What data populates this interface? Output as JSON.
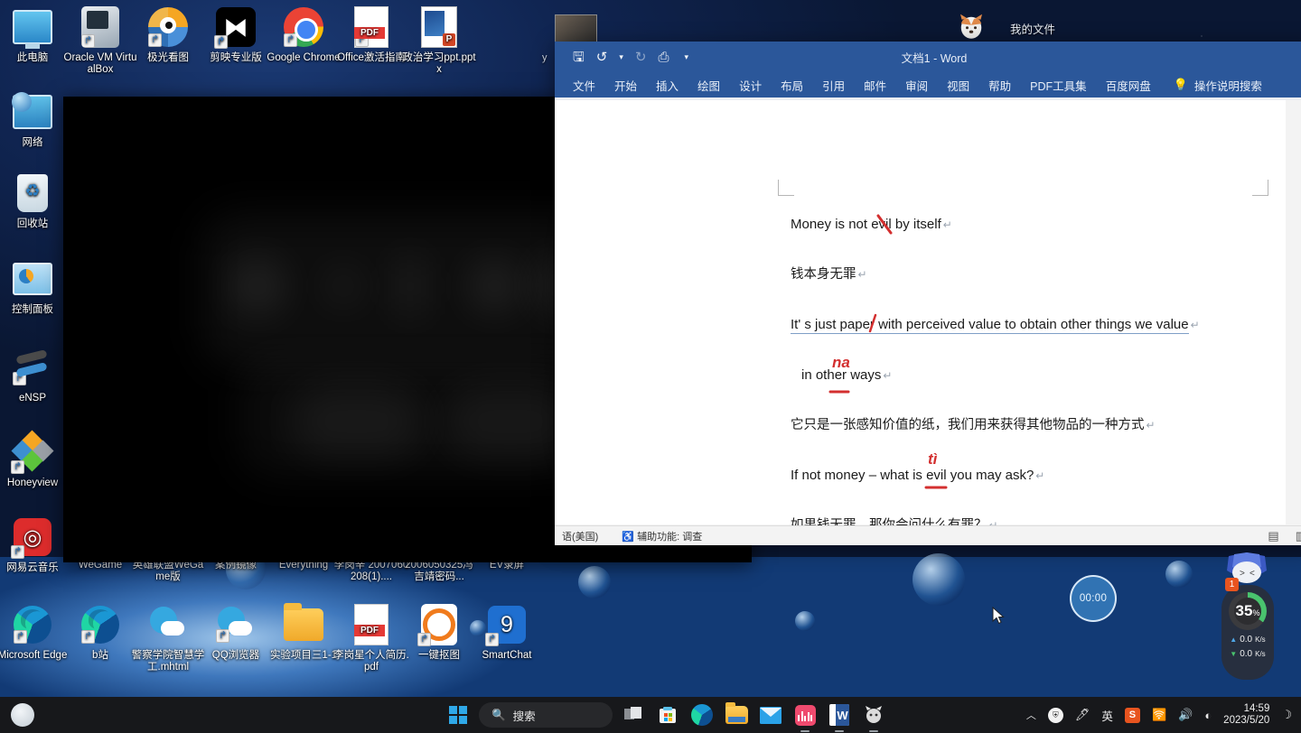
{
  "desktop": {
    "icons_top": [
      {
        "label": "此电脑",
        "icon": "this-pc-icon"
      },
      {
        "label": "Oracle VM VirtualBox",
        "icon": "virtualbox-icon"
      },
      {
        "label": "极光看图",
        "icon": "aurora-viewer-icon"
      },
      {
        "label": "剪映专业版",
        "icon": "jianying-icon"
      },
      {
        "label": "Google Chrome",
        "icon": "chrome-icon"
      },
      {
        "label": "Office激活指南",
        "icon": "pdf-file-icon"
      },
      {
        "label": "政治学习ppt.pptx",
        "icon": "powerpoint-file-icon"
      }
    ],
    "icons_left": [
      {
        "label": "网络",
        "icon": "network-icon"
      },
      {
        "label": "回收站",
        "icon": "recycle-bin-icon"
      },
      {
        "label": "控制面板",
        "icon": "control-panel-icon"
      },
      {
        "label": "eNSP",
        "icon": "ensp-icon"
      },
      {
        "label": "Honeyview",
        "icon": "honeyview-icon"
      },
      {
        "label": "网易云音乐",
        "icon": "netease-music-icon"
      }
    ],
    "icons_row_labels": [
      {
        "label": "WeGame"
      },
      {
        "label": "英雄联盟WeGame版"
      },
      {
        "label": "案例镜像"
      },
      {
        "label": "Everything"
      },
      {
        "label": "李岗辛 2007060208(1)...."
      },
      {
        "label": "2006050325冯吉靖密码..."
      },
      {
        "label": "EV录屏"
      }
    ],
    "icons_bottom": [
      {
        "label": "Microsoft Edge",
        "icon": "edge-icon"
      },
      {
        "label": "b站",
        "icon": "bilibili-icon"
      },
      {
        "label": "警察学院智慧学工.mhtml",
        "icon": "mhtml-file-icon"
      },
      {
        "label": "QQ浏览器",
        "icon": "qq-browser-icon"
      },
      {
        "label": "实验项目三1-1",
        "icon": "folder-icon"
      },
      {
        "label": "李岗星个人简历.pdf",
        "icon": "pdf-file-icon"
      },
      {
        "label": "一键抠图",
        "icon": "one-click-cutout-icon"
      },
      {
        "label": "SmartChat",
        "icon": "smartchat-icon"
      }
    ],
    "my_files": {
      "label": "我的文件",
      "icon": "dog-pet-icon"
    }
  },
  "word": {
    "title": "文档1 - Word",
    "quick_access": [
      {
        "name": "save-icon",
        "glyph": "🖫"
      },
      {
        "name": "undo-icon",
        "glyph": "↺"
      },
      {
        "name": "undo-dropdown-icon",
        "glyph": "⌄"
      },
      {
        "name": "redo-icon",
        "glyph": "↻"
      },
      {
        "name": "customize-toolbar-icon",
        "glyph": "⎙"
      },
      {
        "name": "qat-more-icon",
        "glyph": "⌄"
      }
    ],
    "tabs": [
      "文件",
      "开始",
      "插入",
      "绘图",
      "设计",
      "布局",
      "引用",
      "邮件",
      "审阅",
      "视图",
      "帮助",
      "PDF工具集",
      "百度网盘"
    ],
    "tell_me": "操作说明搜索",
    "document_lines": [
      {
        "text": "Money is not evil by itself",
        "lang": "en"
      },
      {
        "text": "钱本身无罪",
        "lang": "cn"
      },
      {
        "text": "It'  s   just paper with perceived value to obtain other things we value",
        "lang": "en"
      },
      {
        "text": "in other ways",
        "lang": "en"
      },
      {
        "text": "它只是一张感知价值的纸，我们用来获得其他物品的一种方式",
        "lang": "cn"
      },
      {
        "text": "If not money  –  what is evil you may ask?",
        "lang": "en"
      },
      {
        "text": "如果钱无罪，那你会问什么有罪？",
        "lang": "cn"
      }
    ],
    "annotations": [
      {
        "text": "na",
        "name": "red-annotation-na"
      },
      {
        "text": "tì",
        "name": "red-annotation-ti"
      }
    ],
    "status_bar": {
      "language": "语(美国)",
      "accessibility": "辅助功能: 调查"
    }
  },
  "widgets": {
    "timer": "00:00",
    "network": {
      "badge": "1",
      "cpu_percent": "35",
      "percent_symbol": "%",
      "upload": "0.0",
      "download": "0.0",
      "unit": "K/s"
    }
  },
  "taskbar": {
    "search_placeholder": "搜索",
    "items": [
      {
        "name": "start-button"
      },
      {
        "name": "search-button"
      },
      {
        "name": "task-view-button"
      },
      {
        "name": "microsoft-store-button"
      },
      {
        "name": "edge-button"
      },
      {
        "name": "file-explorer-button"
      },
      {
        "name": "mail-button"
      },
      {
        "name": "recorder-button"
      },
      {
        "name": "word-button"
      },
      {
        "name": "pet-app-button"
      }
    ],
    "tray": [
      {
        "name": "show-hidden-icons-icon",
        "glyph": "︿"
      },
      {
        "name": "security-center-icon",
        "glyph": "◉"
      },
      {
        "name": "pen-icon",
        "glyph": "🖊"
      },
      {
        "name": "ime-icon",
        "glyph": "英"
      },
      {
        "name": "snipaste-icon",
        "glyph": "S"
      },
      {
        "name": "wifi-icon",
        "glyph": "◗"
      },
      {
        "name": "volume-icon",
        "glyph": "🔊"
      },
      {
        "name": "battery-icon",
        "glyph": "◐"
      }
    ],
    "clock": {
      "time": "14:59",
      "date": "2023/5/20"
    },
    "notification_glyph": "☽"
  }
}
